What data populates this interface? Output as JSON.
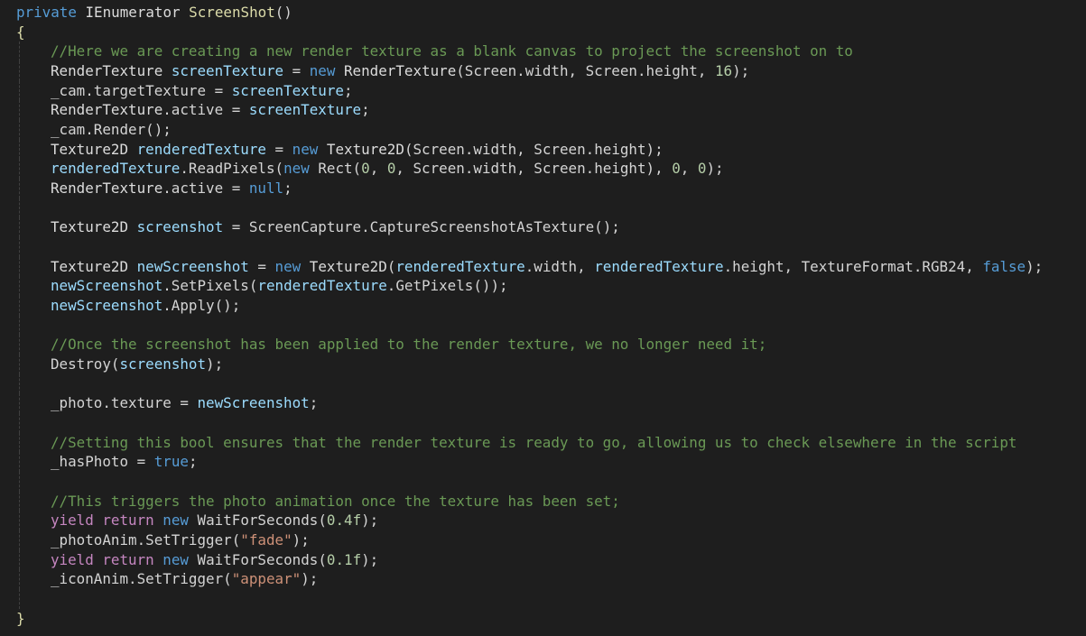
{
  "theme": {
    "background": "#1e1e1e",
    "colors": {
      "kw": "#569cd6",
      "ctrl": "#c586c0",
      "type": "#4ec9b0",
      "func": "#dcdcaa",
      "var": "#9cdcfe",
      "plain": "#d4d4d4",
      "cmt": "#6a9955",
      "num": "#b5cea8",
      "str": "#ce9178"
    }
  },
  "code": {
    "lines": [
      {
        "indent": 0,
        "tokens": [
          [
            "kw",
            "private"
          ],
          [
            "plain",
            " "
          ],
          [
            "ident",
            "IEnumerator"
          ],
          [
            "plain",
            " "
          ],
          [
            "func",
            "ScreenShot"
          ],
          [
            "plain",
            "()"
          ]
        ]
      },
      {
        "indent": 0,
        "tokens": [
          [
            "func",
            "{"
          ]
        ]
      },
      {
        "indent": 1,
        "tokens": [
          [
            "cmt",
            "//Here we are creating a new render texture as a blank canvas to project the screenshot on to"
          ]
        ]
      },
      {
        "indent": 1,
        "tokens": [
          [
            "ident",
            "RenderTexture"
          ],
          [
            "plain",
            " "
          ],
          [
            "var",
            "screenTexture"
          ],
          [
            "plain",
            " = "
          ],
          [
            "kw",
            "new"
          ],
          [
            "plain",
            " "
          ],
          [
            "ident",
            "RenderTexture"
          ],
          [
            "plain",
            "(Screen.width, Screen.height, "
          ],
          [
            "num",
            "16"
          ],
          [
            "plain",
            ");"
          ]
        ]
      },
      {
        "indent": 1,
        "tokens": [
          [
            "plain",
            "_cam.targetTexture = "
          ],
          [
            "var",
            "screenTexture"
          ],
          [
            "plain",
            ";"
          ]
        ]
      },
      {
        "indent": 1,
        "tokens": [
          [
            "ident",
            "RenderTexture"
          ],
          [
            "plain",
            ".active = "
          ],
          [
            "var",
            "screenTexture"
          ],
          [
            "plain",
            ";"
          ]
        ]
      },
      {
        "indent": 1,
        "tokens": [
          [
            "plain",
            "_cam.Render();"
          ]
        ]
      },
      {
        "indent": 1,
        "tokens": [
          [
            "ident",
            "Texture2D"
          ],
          [
            "plain",
            " "
          ],
          [
            "var",
            "renderedTexture"
          ],
          [
            "plain",
            " = "
          ],
          [
            "kw",
            "new"
          ],
          [
            "plain",
            " "
          ],
          [
            "ident",
            "Texture2D"
          ],
          [
            "plain",
            "(Screen.width, Screen.height);"
          ]
        ]
      },
      {
        "indent": 1,
        "tokens": [
          [
            "var",
            "renderedTexture"
          ],
          [
            "plain",
            ".ReadPixels("
          ],
          [
            "kw",
            "new"
          ],
          [
            "plain",
            " Rect("
          ],
          [
            "num",
            "0"
          ],
          [
            "plain",
            ", "
          ],
          [
            "num",
            "0"
          ],
          [
            "plain",
            ", Screen.width, Screen.height), "
          ],
          [
            "num",
            "0"
          ],
          [
            "plain",
            ", "
          ],
          [
            "num",
            "0"
          ],
          [
            "plain",
            ");"
          ]
        ]
      },
      {
        "indent": 1,
        "tokens": [
          [
            "ident",
            "RenderTexture"
          ],
          [
            "plain",
            ".active = "
          ],
          [
            "kw",
            "null"
          ],
          [
            "plain",
            ";"
          ]
        ]
      },
      {
        "indent": 1,
        "tokens": []
      },
      {
        "indent": 1,
        "tokens": [
          [
            "ident",
            "Texture2D"
          ],
          [
            "plain",
            " "
          ],
          [
            "var",
            "screenshot"
          ],
          [
            "plain",
            " = ScreenCapture.CaptureScreenshotAsTexture();"
          ]
        ]
      },
      {
        "indent": 1,
        "tokens": []
      },
      {
        "indent": 1,
        "tokens": [
          [
            "ident",
            "Texture2D"
          ],
          [
            "plain",
            " "
          ],
          [
            "var",
            "newScreenshot"
          ],
          [
            "plain",
            " = "
          ],
          [
            "kw",
            "new"
          ],
          [
            "plain",
            " "
          ],
          [
            "ident",
            "Texture2D"
          ],
          [
            "plain",
            "("
          ],
          [
            "var",
            "renderedTexture"
          ],
          [
            "plain",
            ".width, "
          ],
          [
            "var",
            "renderedTexture"
          ],
          [
            "plain",
            ".height, TextureFormat.RGB24, "
          ],
          [
            "kw",
            "false"
          ],
          [
            "plain",
            ");"
          ]
        ]
      },
      {
        "indent": 1,
        "tokens": [
          [
            "var",
            "newScreenshot"
          ],
          [
            "plain",
            ".SetPixels("
          ],
          [
            "var",
            "renderedTexture"
          ],
          [
            "plain",
            ".GetPixels());"
          ]
        ]
      },
      {
        "indent": 1,
        "tokens": [
          [
            "var",
            "newScreenshot"
          ],
          [
            "plain",
            ".Apply();"
          ]
        ]
      },
      {
        "indent": 1,
        "tokens": []
      },
      {
        "indent": 1,
        "tokens": [
          [
            "cmt",
            "//Once the screenshot has been applied to the render texture, we no longer need it;"
          ]
        ]
      },
      {
        "indent": 1,
        "tokens": [
          [
            "plain",
            "Destroy("
          ],
          [
            "var",
            "screenshot"
          ],
          [
            "plain",
            ");"
          ]
        ]
      },
      {
        "indent": 1,
        "tokens": []
      },
      {
        "indent": 1,
        "tokens": [
          [
            "plain",
            "_photo.texture = "
          ],
          [
            "var",
            "newScreenshot"
          ],
          [
            "plain",
            ";"
          ]
        ]
      },
      {
        "indent": 1,
        "tokens": []
      },
      {
        "indent": 1,
        "tokens": [
          [
            "cmt",
            "//Setting this bool ensures that the render texture is ready to go, allowing us to check elsewhere in the script"
          ]
        ]
      },
      {
        "indent": 1,
        "tokens": [
          [
            "plain",
            "_hasPhoto = "
          ],
          [
            "kw",
            "true"
          ],
          [
            "plain",
            ";"
          ]
        ]
      },
      {
        "indent": 1,
        "tokens": []
      },
      {
        "indent": 1,
        "tokens": [
          [
            "cmt",
            "//This triggers the photo animation once the texture has been set;"
          ]
        ]
      },
      {
        "indent": 1,
        "tokens": [
          [
            "ctrl",
            "yield"
          ],
          [
            "plain",
            " "
          ],
          [
            "ctrl",
            "return"
          ],
          [
            "plain",
            " "
          ],
          [
            "kw",
            "new"
          ],
          [
            "plain",
            " WaitForSeconds("
          ],
          [
            "num",
            "0.4f"
          ],
          [
            "plain",
            ");"
          ]
        ]
      },
      {
        "indent": 1,
        "tokens": [
          [
            "plain",
            "_photoAnim.SetTrigger("
          ],
          [
            "str",
            "\"fade\""
          ],
          [
            "plain",
            ");"
          ]
        ]
      },
      {
        "indent": 1,
        "tokens": [
          [
            "ctrl",
            "yield"
          ],
          [
            "plain",
            " "
          ],
          [
            "ctrl",
            "return"
          ],
          [
            "plain",
            " "
          ],
          [
            "kw",
            "new"
          ],
          [
            "plain",
            " WaitForSeconds("
          ],
          [
            "num",
            "0.1f"
          ],
          [
            "plain",
            ");"
          ]
        ]
      },
      {
        "indent": 1,
        "tokens": [
          [
            "plain",
            "_iconAnim.SetTrigger("
          ],
          [
            "str",
            "\"appear\""
          ],
          [
            "plain",
            ");"
          ]
        ]
      },
      {
        "indent": 1,
        "tokens": []
      },
      {
        "indent": 0,
        "tokens": [
          [
            "func",
            "}"
          ]
        ]
      }
    ]
  }
}
